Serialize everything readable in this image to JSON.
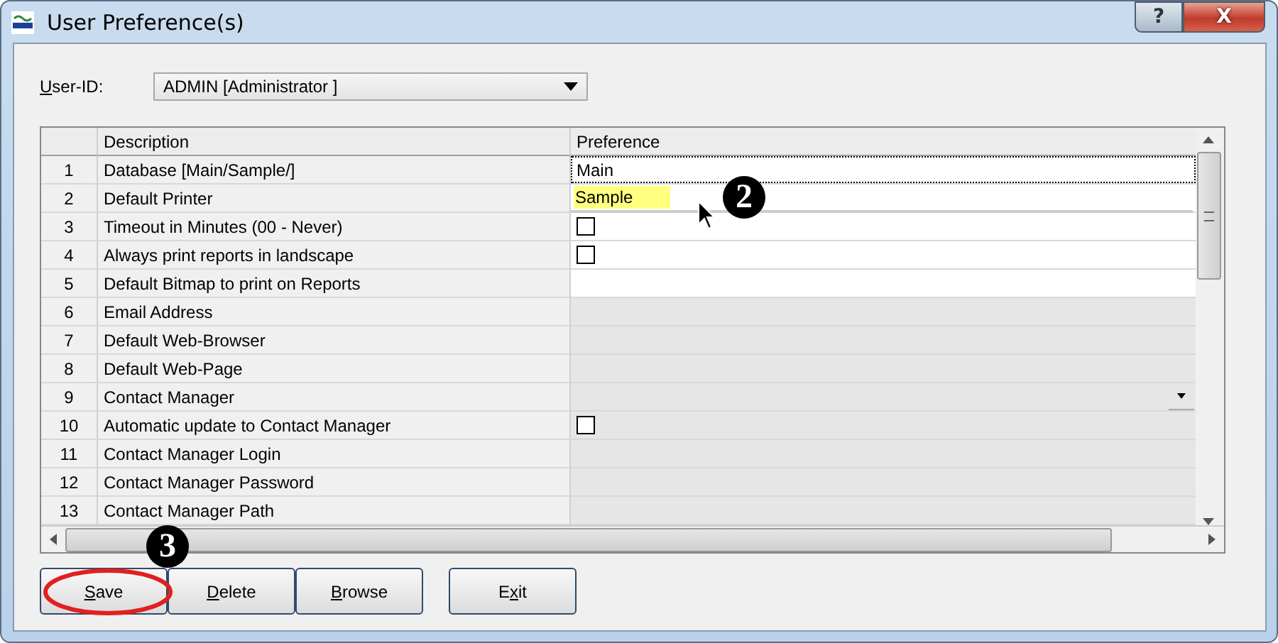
{
  "window": {
    "title": "User Preference(s)"
  },
  "title_buttons": [
    {
      "kind": "help",
      "label": "?"
    },
    {
      "kind": "close",
      "label": "X"
    }
  ],
  "user_id": {
    "access_key": "U",
    "label_after": "ser-ID:",
    "value": "ADMIN [Administrator ]"
  },
  "table": {
    "columns": [
      "Description",
      "Preference"
    ],
    "rows": [
      {
        "number": "1",
        "description": "Database [Main/Sample/]",
        "kind": "text",
        "value": "Main",
        "editable": true,
        "focused": true
      },
      {
        "number": "2",
        "description": "Default Printer",
        "kind": "text",
        "editable": true,
        "focused": false
      },
      {
        "number": "3",
        "description": "Timeout in Minutes (00 - Never)",
        "kind": "checkbox",
        "checked": false,
        "editable": true,
        "focused": false
      },
      {
        "number": "4",
        "description": "Always print reports in landscape",
        "kind": "checkbox",
        "checked": false,
        "editable": true,
        "focused": false
      },
      {
        "number": "5",
        "description": "Default Bitmap to print on Reports",
        "kind": "text",
        "editable": true,
        "focused": false
      },
      {
        "number": "6",
        "description": "Email Address",
        "kind": "text",
        "editable": false,
        "focused": false
      },
      {
        "number": "7",
        "description": "Default Web-Browser",
        "kind": "text",
        "editable": false,
        "focused": false
      },
      {
        "number": "8",
        "description": "Default Web-Page",
        "kind": "text",
        "editable": false,
        "focused": false
      },
      {
        "number": "9",
        "description": "Contact Manager",
        "kind": "combo",
        "editable": false,
        "focused": false
      },
      {
        "number": "10",
        "description": "Automatic update to Contact Manager",
        "kind": "checkbox",
        "checked": false,
        "editable": false,
        "focused": false
      },
      {
        "number": "11",
        "description": "Contact Manager Login",
        "kind": "text",
        "editable": false,
        "focused": false
      },
      {
        "number": "12",
        "description": "Contact Manager Password",
        "kind": "text",
        "editable": false,
        "focused": false
      },
      {
        "number": "13",
        "description": "Contact Manager Path",
        "kind": "text",
        "editable": false,
        "focused": false
      }
    ]
  },
  "dropdown_list": {
    "items": [
      {
        "label": "Sample",
        "selected": true
      }
    ]
  },
  "buttons": [
    {
      "access_key": "S",
      "label_after": "ave",
      "circled": true
    },
    {
      "access_key": "D",
      "label_after": "elete",
      "circled": false
    },
    {
      "access_key": "B",
      "label_after": "rowse",
      "circled": false
    },
    {
      "label_before": "E",
      "access_key": "x",
      "label_after": "it",
      "circled": false
    }
  ],
  "annotations": [
    {
      "kind": "step",
      "label": "2"
    },
    {
      "kind": "step",
      "label": "3"
    }
  ]
}
